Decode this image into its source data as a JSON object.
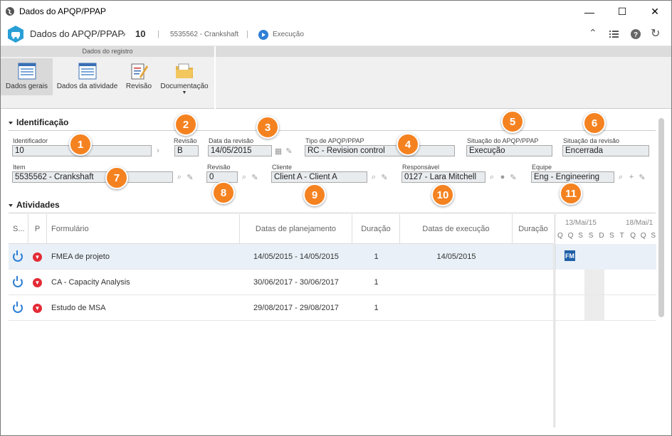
{
  "window": {
    "title": "Dados do APQP/PPAP",
    "minimize": "—",
    "maximize": "☐",
    "close": "✕"
  },
  "appbar": {
    "title": "Dados do APQP/PPAP",
    "number": "10",
    "item": "5535562 - Crankshaft",
    "status": "Execução"
  },
  "ribbon": {
    "group": "Dados do registro",
    "buttons": [
      "Dados gerais",
      "Dados da atividade",
      "Revisão",
      "Documentação"
    ]
  },
  "identificacao": {
    "title": "Identificação",
    "identificador": {
      "label": "Identificador",
      "value": "10"
    },
    "revisao": {
      "label": "Revisão",
      "value": "B"
    },
    "data_revisao": {
      "label": "Data da revisão",
      "value": "14/05/2015"
    },
    "tipo": {
      "label": "Tipo de APQP/PPAP",
      "value": "RC - Revision control"
    },
    "situacao_apqp": {
      "label": "Situação do APQP/PPAP",
      "value": "Execução"
    },
    "situacao_revisao": {
      "label": "Situação da revisão",
      "value": "Encerrada"
    },
    "item": {
      "label": "Item",
      "value": "5535562 - Crankshaft"
    },
    "revisao2": {
      "label": "Revisão",
      "value": "0"
    },
    "cliente": {
      "label": "Cliente",
      "value": "Client A - Client A"
    },
    "responsavel": {
      "label": "Responsável",
      "value": "0127 - Lara Mitchell"
    },
    "equipe": {
      "label": "Equipe",
      "value": "Eng - Engineering"
    }
  },
  "badges": [
    "1",
    "2",
    "3",
    "4",
    "5",
    "6",
    "7",
    "8",
    "9",
    "10",
    "11"
  ],
  "atividades": {
    "title": "Atividades",
    "columns": [
      "S...",
      "P",
      "Formulário",
      "Datas de planejamento",
      "Duração",
      "Datas de execução",
      "Duração"
    ],
    "rows": [
      {
        "form": "FMEA de projeto",
        "plan": "14/05/2015 - 14/05/2015",
        "dur": "1",
        "exec": "14/05/2015"
      },
      {
        "form": "CA - Capacity Analysis",
        "plan": "30/06/2017 - 30/06/2017",
        "dur": "1",
        "exec": ""
      },
      {
        "form": "Estudo de MSA",
        "plan": "29/08/2017 - 29/08/2017",
        "dur": "1",
        "exec": ""
      }
    ],
    "gantt": {
      "date1": "13/Mai/15",
      "date2": "18/Mai/1",
      "days": [
        "Q",
        "Q",
        "S",
        "S",
        "D",
        "S",
        "T",
        "Q",
        "Q",
        "S"
      ],
      "bar": "FM"
    }
  },
  "colors": {
    "accent": "#2e7ed6",
    "badge": "#f58220",
    "priority": "#e32b36"
  }
}
